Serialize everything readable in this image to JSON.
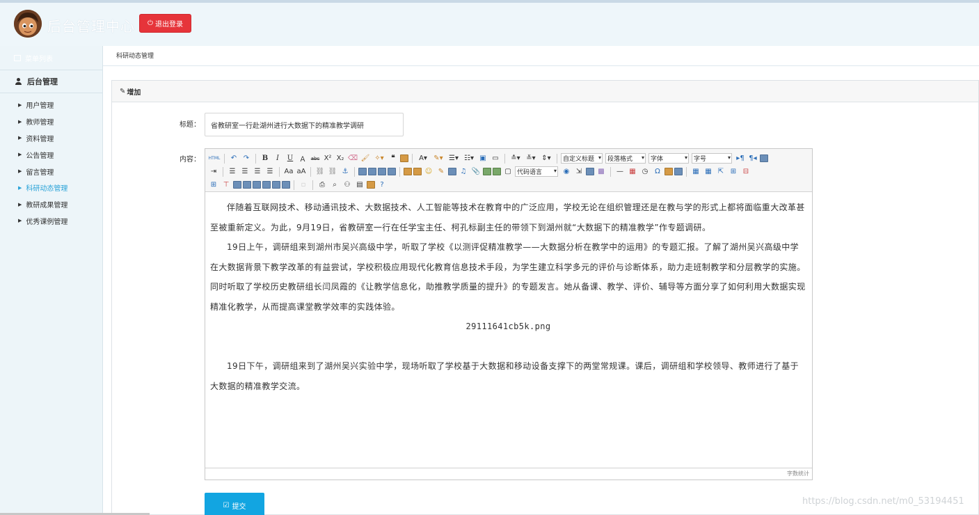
{
  "header": {
    "site_title": "后台管理中心",
    "logout_label": "退出登录",
    "logout_icon": "power-icon",
    "brand_color": "#e6343a"
  },
  "sidebar": {
    "top_label": "菜单列表",
    "group_label": "后台管理",
    "items": [
      {
        "label": "用户管理",
        "active": false
      },
      {
        "label": "教师管理",
        "active": false
      },
      {
        "label": "资料管理",
        "active": false
      },
      {
        "label": "公告管理",
        "active": false
      },
      {
        "label": "留言管理",
        "active": false
      },
      {
        "label": "科研动态管理",
        "active": true
      },
      {
        "label": "教研成果管理",
        "active": false
      },
      {
        "label": "优秀课例管理",
        "active": false
      }
    ],
    "active_color": "#2aa3d8"
  },
  "breadcrumb": "科研动态管理",
  "panel": {
    "heading": "增加"
  },
  "form": {
    "title_label": "标题：",
    "title_value": "省教研室一行赴湖州进行大数据下的精准教学调研",
    "content_label": "内容：",
    "submit_label": "提交"
  },
  "editor": {
    "toolbar": {
      "html_label": "HTML",
      "custom_title": "自定义标题",
      "paragraph": "段落格式",
      "font": "字体",
      "font_size": "字号",
      "code_language": "代码语言"
    },
    "paragraphs": [
      "伴随着互联网技术、移动通讯技术、大数据技术、人工智能等技术在教育中的广泛应用，学校无论在组织管理还是在教与学的形式上都将面临重大改革甚至被重新定义。为此，9月19日，省教研室一行在任学宝主任、柯孔标副主任的带领下到湖州就“大数据下的精准教学”作专题调研。",
      "19日上午，调研组来到湖州市吴兴高级中学，听取了学校《以测评促精准教学——大数据分析在教学中的运用》的专题汇报。了解了湖州吴兴高级中学在大数据背景下教学改革的有益尝试，学校积极应用现代化教育信息技术手段，为学生建立科学多元的评价与诊断体系，助力走班制教学和分层教学的实施。同时听取了学校历史教研组长闫凤霞的《让教学信息化，助推教学质量的提升》的专题发言。她从备课、教学、评价、辅导等方面分享了如何利用大数据实现精准化教学，从而提高课堂教学效率的实践体验。"
    ],
    "image_name": "29111641cb5k.png",
    "paragraph_after": "19日下午，调研组来到了湖州吴兴实验中学，现场听取了学校基于大数据和移动设备支撑下的两堂常规课。课后，调研组和学校领导、教师进行了基于大数据的精准教学交流。",
    "word_count_label": "字数统计"
  },
  "watermark": "https://blog.csdn.net/m0_53194451"
}
